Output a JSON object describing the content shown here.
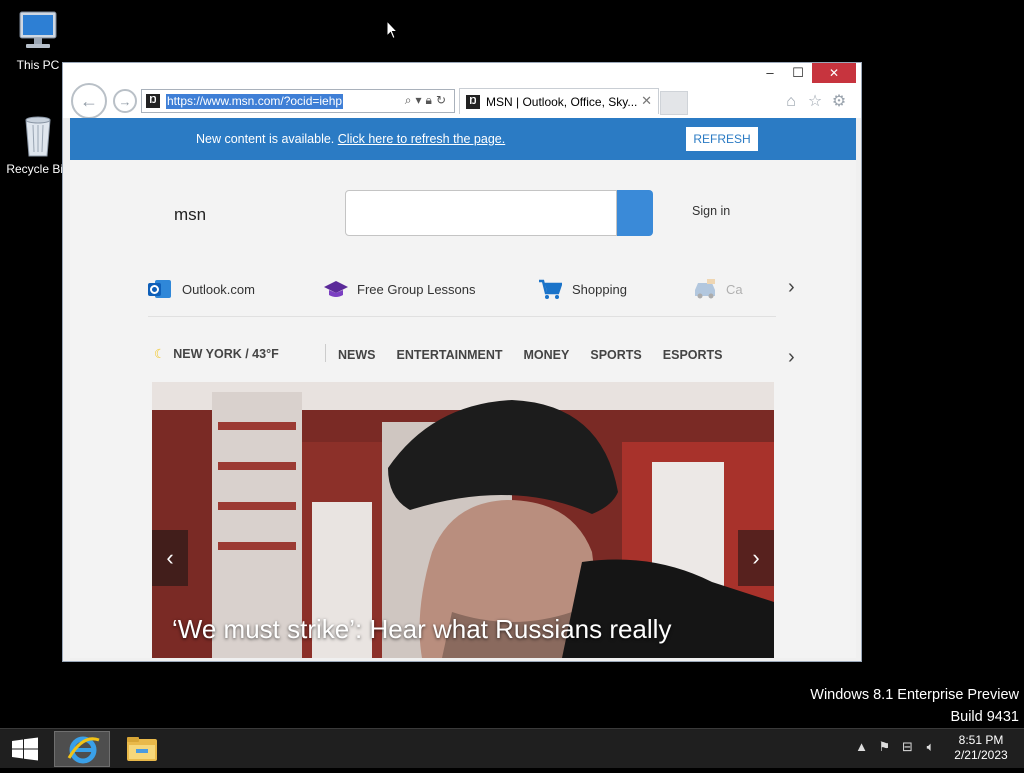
{
  "desktop": {
    "icons": [
      {
        "label": "This PC"
      },
      {
        "label": "Recycle Bin"
      }
    ],
    "watermark_line1": "Windows 8.1 Enterprise Preview",
    "watermark_line2": "Build 9431"
  },
  "ie": {
    "address": "https://www.msn.com/?ocid=iehp",
    "tab_title": "MSN | Outlook, Office, Sky...",
    "close_glyph": "✕",
    "notification": {
      "message": "New content is available.",
      "link": "Click here to refresh the page.",
      "button": "REFRESH"
    }
  },
  "msn": {
    "logo": "msn",
    "search_placeholder": "",
    "signin": "Sign in",
    "quick_links": [
      {
        "label": "Outlook.com",
        "icon": "outlook-icon"
      },
      {
        "label": "Free Group Lessons",
        "icon": "graduation-cap-icon"
      },
      {
        "label": "Shopping",
        "icon": "shopping-cart-icon"
      },
      {
        "label": "Ca",
        "icon": "car-icon"
      }
    ],
    "weather": "NEW YORK / 43°F",
    "categories": [
      "NEWS",
      "ENTERTAINMENT",
      "MONEY",
      "SPORTS",
      "ESPORTS"
    ],
    "hero_caption": "‘We must strike’: Hear what Russians really"
  },
  "taskbar": {
    "time": "8:51 PM",
    "date": "2/21/2023"
  },
  "colors": {
    "notice_blue": "#2b7bc4",
    "close_red": "#c7343e",
    "search_blue": "#3a8ad8"
  }
}
